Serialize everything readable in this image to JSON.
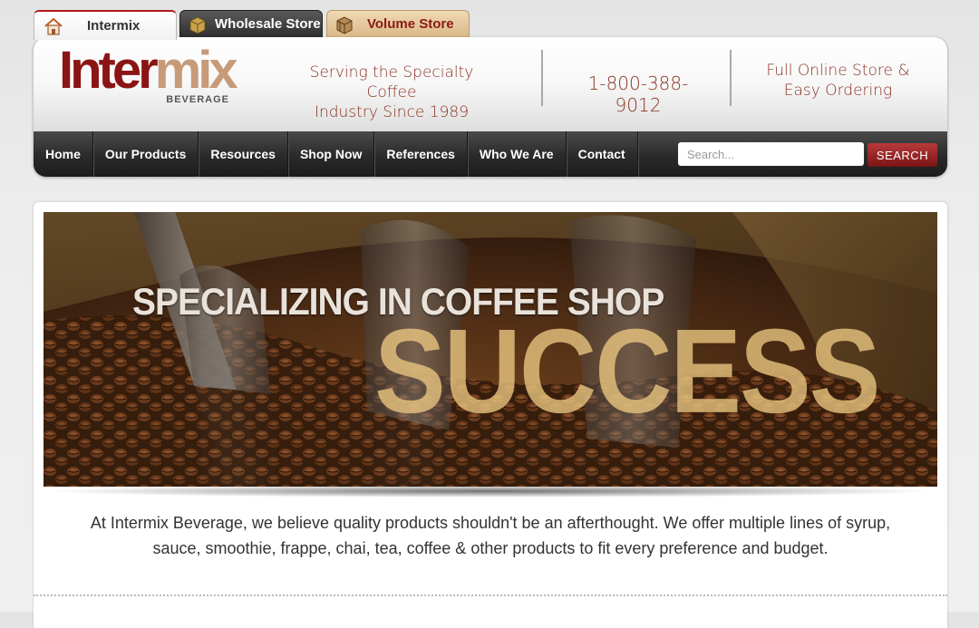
{
  "store_tabs": [
    {
      "label": "Intermix",
      "icon": "home-icon"
    },
    {
      "label": "Wholesale Store",
      "icon": "box-icon"
    },
    {
      "label": "Volume Store",
      "icon": "crate-icon"
    }
  ],
  "logo": {
    "main_a": "Inter",
    "main_b": "mix",
    "sub": "BEVERAGE"
  },
  "header": {
    "tagline_1": "Serving the Specialty Coffee",
    "tagline_2": "Industry Since 1989",
    "phone": "1-800-388-9012",
    "online_1": "Full Online Store &",
    "online_2": "Easy Ordering"
  },
  "nav": {
    "items": [
      "Home",
      "Our Products",
      "Resources",
      "Shop Now",
      "References",
      "Who We Are",
      "Contact"
    ],
    "search_placeholder": "Search...",
    "search_button": "SEARCH"
  },
  "banner": {
    "line1": "SPECIALIZING IN COFFEE SHOP",
    "line2": "SUCCESS"
  },
  "intro": {
    "line1": "At Intermix Beverage, we believe quality products shouldn't be an afterthought. We offer multiple lines of syrup,",
    "line2": "sauce, smoothie, frappe, chai, tea, coffee & other products to fit every preference and budget."
  },
  "colors": {
    "brand_red": "#8b1414",
    "brand_tan": "#c79a78",
    "header_text": "#8c3324",
    "nav_bg": "#2a2a2a",
    "search_button": "#a12626"
  }
}
